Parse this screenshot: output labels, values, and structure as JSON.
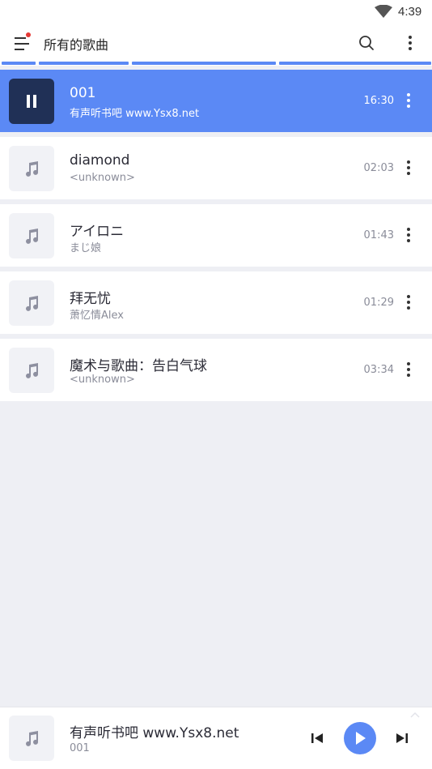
{
  "status_bar": {
    "time": "4:39"
  },
  "app_bar": {
    "title": "所有的歌曲"
  },
  "colors": {
    "accent": "#5b89f5",
    "notification_dot": "#e53935",
    "active_cover": "#203056"
  },
  "songs": [
    {
      "title": "001",
      "artist": "有声听书吧 www.Ysx8.net",
      "duration": "16:30",
      "playing": true
    },
    {
      "title": "diamond",
      "artist": "<unknown>",
      "duration": "02:03",
      "playing": false
    },
    {
      "title": "アイロニ",
      "artist": "まじ娘",
      "duration": "01:43",
      "playing": false
    },
    {
      "title": "拜无忧",
      "artist": "萧忆情Alex",
      "duration": "01:29",
      "playing": false
    },
    {
      "title": "魔术与歌曲：告白气球",
      "artist": "<unknown>",
      "duration": "03:34",
      "playing": false
    }
  ],
  "player": {
    "title": "有声听书吧 www.Ysx8.net",
    "subtitle": "001"
  },
  "icons": {
    "menu": "menu-icon",
    "search": "search-icon",
    "more": "more-vert-icon",
    "music": "music-note-icon",
    "pause": "pause-icon",
    "previous": "skip-previous-icon",
    "play": "play-icon",
    "next": "skip-next-icon"
  }
}
